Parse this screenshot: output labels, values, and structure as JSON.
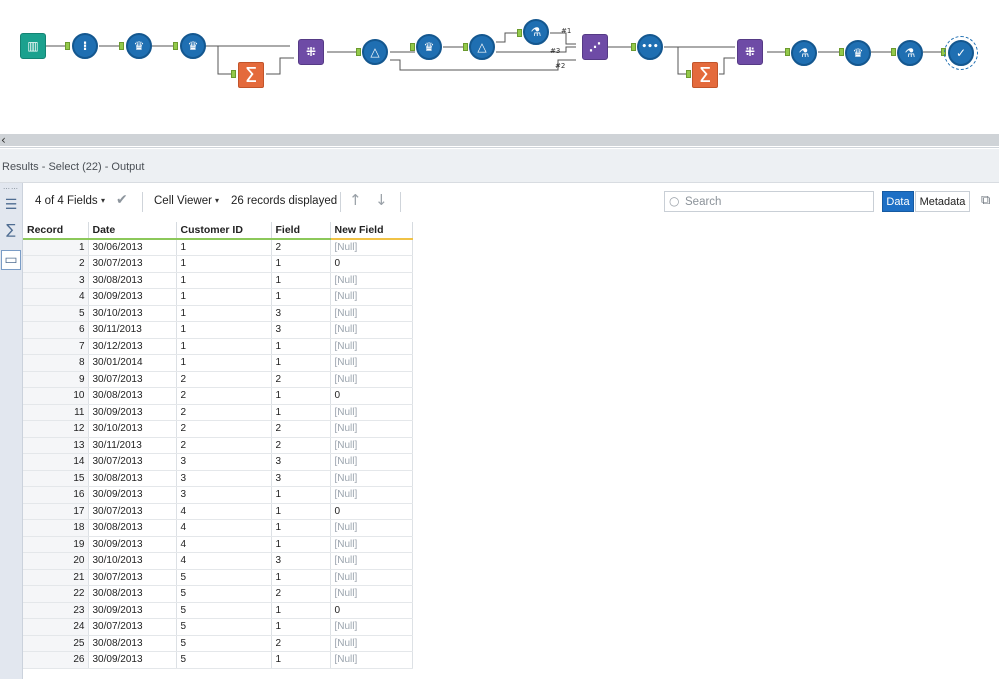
{
  "canvas": {
    "tools": [
      {
        "id": "input",
        "icon": "book-input-icon",
        "glyph": "▥"
      },
      {
        "id": "select1",
        "icon": "select-icon",
        "glyph": "⁝"
      },
      {
        "id": "formula1",
        "icon": "crown-formula-icon",
        "glyph": "♛"
      },
      {
        "id": "formula2",
        "icon": "crown-formula-icon",
        "glyph": "♛"
      },
      {
        "id": "summarize1",
        "icon": "sigma-summarize-icon",
        "glyph": "Σ"
      },
      {
        "id": "join1",
        "icon": "join-icon",
        "glyph": "⁜"
      },
      {
        "id": "filter1",
        "icon": "delta-filter-icon",
        "glyph": "△"
      },
      {
        "id": "formula3",
        "icon": "crown-formula-icon",
        "glyph": "♛"
      },
      {
        "id": "filter2",
        "icon": "delta-filter-icon",
        "glyph": "△"
      },
      {
        "id": "sample1",
        "icon": "flask-sample-icon",
        "glyph": "⚗"
      },
      {
        "id": "union1",
        "icon": "union-icon",
        "glyph": "⋰"
      },
      {
        "id": "dots1",
        "icon": "dots-icon",
        "glyph": "•••"
      },
      {
        "id": "summarize2",
        "icon": "sigma-summarize-icon",
        "glyph": "Σ"
      },
      {
        "id": "join2",
        "icon": "join-icon",
        "glyph": "⁜"
      },
      {
        "id": "sample2",
        "icon": "flask-sample-icon",
        "glyph": "⚗"
      },
      {
        "id": "formula4",
        "icon": "crown-formula-icon",
        "glyph": "♛"
      },
      {
        "id": "sample3",
        "icon": "flask-sample-icon",
        "glyph": "⚗"
      },
      {
        "id": "select22",
        "icon": "checkmark-select-icon",
        "glyph": "✓"
      }
    ],
    "wire_labels": [
      "#1",
      "#3",
      "#2"
    ]
  },
  "splitter": {
    "chevron": "‹"
  },
  "results": {
    "title": "Results - Select (22) - Output"
  },
  "rail": {
    "grip": "⋯⋯",
    "items": [
      {
        "icon": "rows-icon",
        "glyph": "☰"
      },
      {
        "icon": "sigma-icon",
        "glyph": "∑"
      },
      {
        "icon": "tag-icon",
        "glyph": "▭"
      }
    ]
  },
  "toolbar": {
    "fields_label": "4 of 4 Fields",
    "caret": "▾",
    "check": "✔",
    "cell_viewer_label": "Cell Viewer",
    "records_label": "26 records displayed",
    "up_arrow": "↑",
    "down_arrow": "↓",
    "search_icon": "○",
    "search_placeholder": "Search",
    "data_label": "Data",
    "metadata_label": "Metadata",
    "copy_icon": "⧉"
  },
  "table": {
    "headers": [
      "Record",
      "Date",
      "Customer ID",
      "Field",
      "New Field"
    ],
    "rows": [
      [
        "1",
        "30/06/2013",
        "1",
        "2",
        "[Null]"
      ],
      [
        "2",
        "30/07/2013",
        "1",
        "1",
        "0"
      ],
      [
        "3",
        "30/08/2013",
        "1",
        "1",
        "[Null]"
      ],
      [
        "4",
        "30/09/2013",
        "1",
        "1",
        "[Null]"
      ],
      [
        "5",
        "30/10/2013",
        "1",
        "3",
        "[Null]"
      ],
      [
        "6",
        "30/11/2013",
        "1",
        "3",
        "[Null]"
      ],
      [
        "7",
        "30/12/2013",
        "1",
        "1",
        "[Null]"
      ],
      [
        "8",
        "30/01/2014",
        "1",
        "1",
        "[Null]"
      ],
      [
        "9",
        "30/07/2013",
        "2",
        "2",
        "[Null]"
      ],
      [
        "10",
        "30/08/2013",
        "2",
        "1",
        "0"
      ],
      [
        "11",
        "30/09/2013",
        "2",
        "1",
        "[Null]"
      ],
      [
        "12",
        "30/10/2013",
        "2",
        "2",
        "[Null]"
      ],
      [
        "13",
        "30/11/2013",
        "2",
        "2",
        "[Null]"
      ],
      [
        "14",
        "30/07/2013",
        "3",
        "3",
        "[Null]"
      ],
      [
        "15",
        "30/08/2013",
        "3",
        "3",
        "[Null]"
      ],
      [
        "16",
        "30/09/2013",
        "3",
        "1",
        "[Null]"
      ],
      [
        "17",
        "30/07/2013",
        "4",
        "1",
        "0"
      ],
      [
        "18",
        "30/08/2013",
        "4",
        "1",
        "[Null]"
      ],
      [
        "19",
        "30/09/2013",
        "4",
        "1",
        "[Null]"
      ],
      [
        "20",
        "30/10/2013",
        "4",
        "3",
        "[Null]"
      ],
      [
        "21",
        "30/07/2013",
        "5",
        "1",
        "[Null]"
      ],
      [
        "22",
        "30/08/2013",
        "5",
        "2",
        "[Null]"
      ],
      [
        "23",
        "30/09/2013",
        "5",
        "1",
        "0"
      ],
      [
        "24",
        "30/07/2013",
        "5",
        "1",
        "[Null]"
      ],
      [
        "25",
        "30/08/2013",
        "5",
        "2",
        "[Null]"
      ],
      [
        "26",
        "30/09/2013",
        "5",
        "1",
        "[Null]"
      ]
    ]
  },
  "colors": {
    "tool_blue": "#1f6fb2",
    "tool_purple": "#6e4ba6",
    "tool_orange": "#e46a3c",
    "tool_teal": "#1ba18e",
    "anchor_green": "#93c94a",
    "data_button": "#1d6fc5",
    "null_text": "#9aa3ad"
  }
}
